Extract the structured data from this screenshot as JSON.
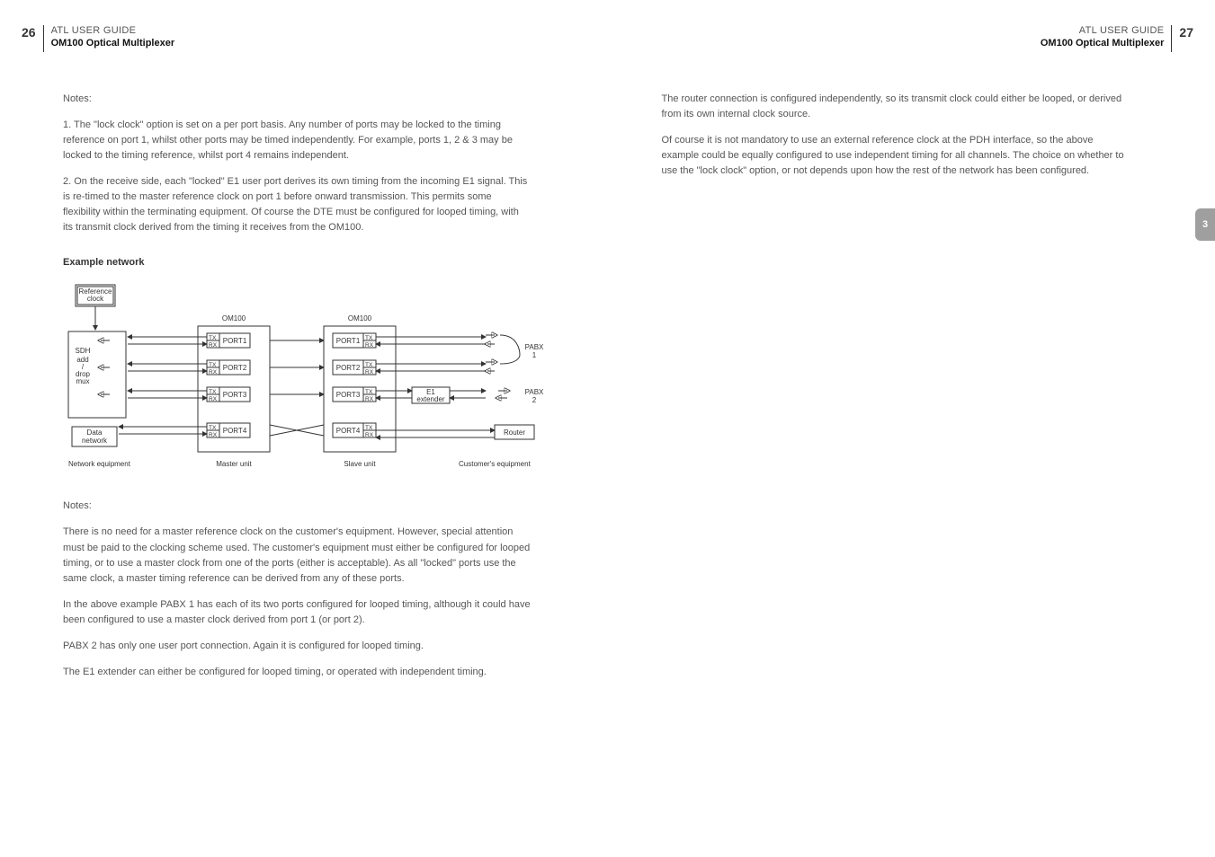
{
  "left": {
    "page_number": "26",
    "header_top": "ATL USER GUIDE",
    "header_sub": "OM100 Optical Multiplexer",
    "notes_label": "Notes:",
    "p1": "1.   The \"lock clock\" option is set on a per port basis. Any number of ports may be locked to the timing reference on port 1, whilst other ports may be timed independently. For example, ports 1, 2 & 3 may be locked to the timing reference, whilst port 4 remains independent.",
    "p2": "2.   On the receive side, each \"locked\" E1 user port derives its own timing from the incoming E1 signal. This is re-timed to the master reference clock on port 1 before onward transmission. This permits some flexibility within the terminating equipment. Of course the DTE must be configured for looped timing, with its transmit clock derived from the timing it receives from the OM100.",
    "section_title": "Example network",
    "diagram": {
      "ref_clock": "Reference\nclock",
      "sdh_box": "SDH\nadd\n/\ndrop\nmux",
      "data_network": "Data\nnetwork",
      "om_label_left": "OM100",
      "om_label_right": "OM100",
      "port_prefix": "PORT",
      "tx": "TX",
      "rx": "RX",
      "e1_extender": "E1\nextender",
      "pabx1": "PABX\n1",
      "pabx2": "PABX\n2",
      "router": "Router",
      "cap_net_eq": "Network equipment",
      "cap_master": "Master unit",
      "cap_slave": "Slave unit",
      "cap_cust": "Customer's equipment"
    },
    "notes2_label": "Notes:",
    "p3": "There is no need for a master reference clock on the customer's equipment. However, special attention must be paid to the clocking scheme used. The customer's equipment must either be configured for looped timing, or to use a master clock from one of the ports (either is acceptable). As all \"locked\" ports use the same clock, a master timing reference can be derived from any of these ports.",
    "p4": "In the above example PABX 1 has each of its two ports configured for looped timing, although it could have been configured to use a master clock derived from port 1 (or port 2).",
    "p5": "PABX 2 has only one user port connection. Again it is configured for looped timing.",
    "p6": "The E1 extender can either be configured for looped timing, or operated with independent timing."
  },
  "right": {
    "page_number": "27",
    "header_top": "ATL USER GUIDE",
    "header_sub": "OM100 Optical Multiplexer",
    "p1": "The router connection is configured independently, so its transmit clock could either be looped, or derived from its own internal clock source.",
    "p2": "Of course it is not mandatory to use an external reference clock at the PDH interface, so the above example could be equally configured to use independent timing for all channels. The choice on whether to use the \"lock clock\" option, or not depends upon how the rest of the network has been configured.",
    "side_tab": "3"
  }
}
